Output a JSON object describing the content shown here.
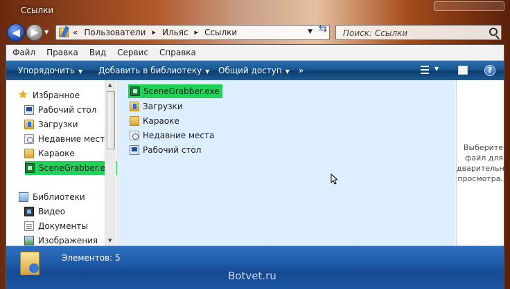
{
  "window": {
    "title": "Ссылки"
  },
  "address": {
    "crumbs": [
      "Пользователи",
      "Ильяс",
      "Ссылки"
    ],
    "prefix": "«",
    "separator": "▸"
  },
  "search": {
    "placeholder": "Поиск: Ссылки"
  },
  "menu": [
    "Файл",
    "Правка",
    "Вид",
    "Сервис",
    "Справка"
  ],
  "toolbar": {
    "organize": "Упорядочить",
    "add_to_library": "Добавить в библиотеку",
    "share": "Общий доступ",
    "more": "»",
    "help": "?"
  },
  "nav": {
    "favorites": "Избранное",
    "favorites_items": [
      "Рабочий стол",
      "Загрузки",
      "Недавние места",
      "Караоке",
      "SceneGrabber.exe"
    ],
    "libraries": "Библиотеки",
    "libraries_items": [
      "Видео",
      "Документы",
      "Изображения"
    ]
  },
  "files": [
    "SceneGrabber.exe",
    "Загрузки",
    "Караоке",
    "Недавние места",
    "Рабочий стол"
  ],
  "preview": {
    "text": "Выберите\nфайл для\nдварительн\nпросмотра."
  },
  "details": {
    "count": "Элементов: 5"
  },
  "watermark": "Botvet.ru",
  "colors": {
    "highlight": "#22d15a",
    "toolbar": "#18568e",
    "filelist_bg": "#ddeefe"
  }
}
